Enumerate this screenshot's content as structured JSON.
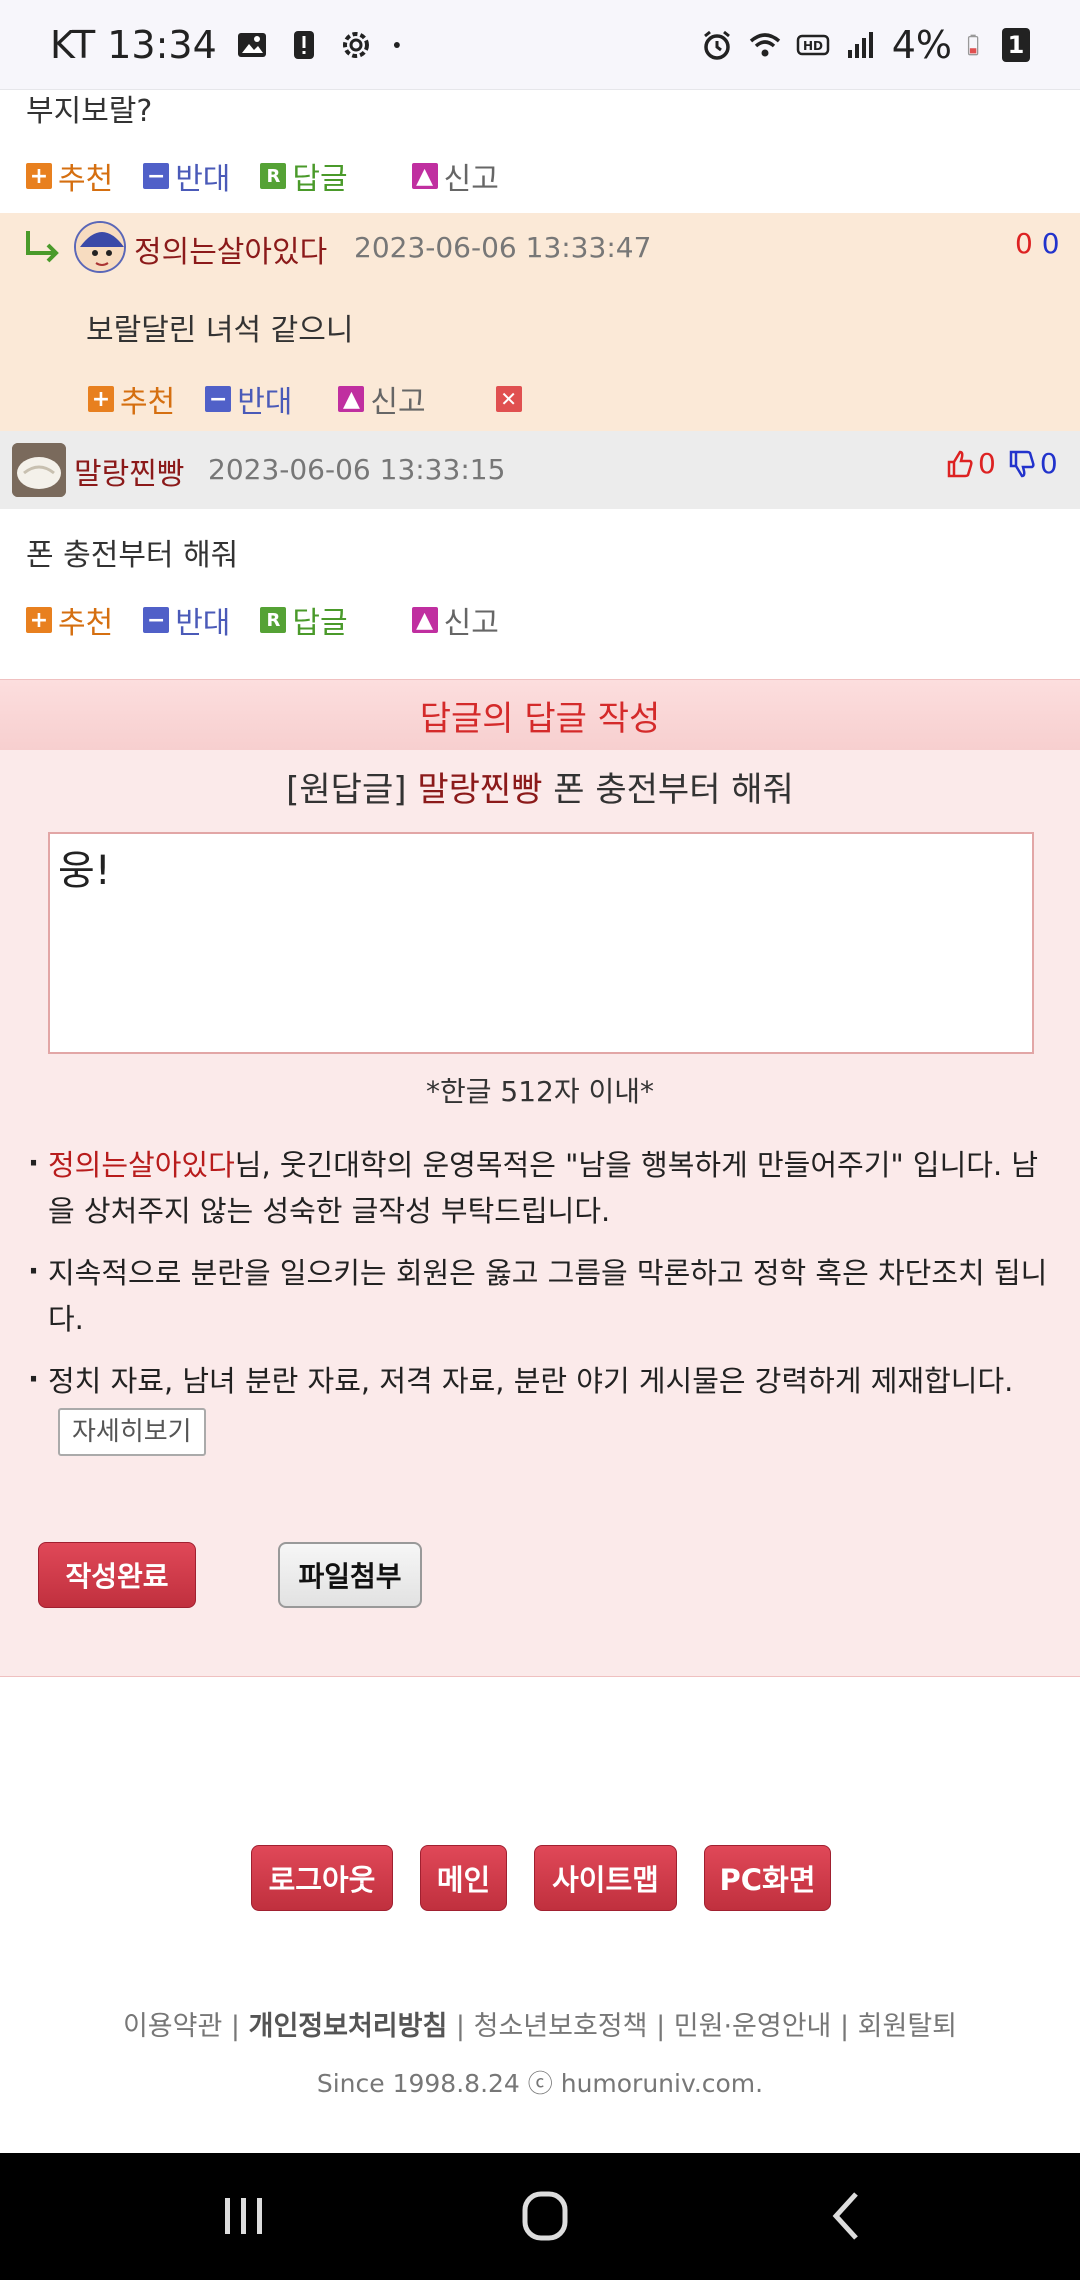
{
  "status_bar": {
    "carrier_time": "KT 13:34",
    "battery": "4%",
    "notification_count": "1"
  },
  "comment1": {
    "partial_text": "부지보랄?",
    "actions": {
      "up": "추천",
      "down": "반대",
      "reply": "답글",
      "report": "신고"
    }
  },
  "reply1": {
    "nickname": "정의는살아있다",
    "date": "2023-06-06 13:33:47",
    "up_count": "0",
    "down_count": "0",
    "text": "보랄달린 녀석 같으니",
    "actions": {
      "up": "추천",
      "down": "반대",
      "report": "신고"
    }
  },
  "comment2": {
    "nickname": "말랑찐빵",
    "date": "2023-06-06 13:33:15",
    "up_count": "0",
    "down_count": "0",
    "text": "폰 충전부터 해줘",
    "actions": {
      "up": "추천",
      "down": "반대",
      "reply": "답글",
      "report": "신고"
    }
  },
  "reply_form": {
    "title": "답글의 답글 작성",
    "orig_prefix": "[원답글]",
    "orig_nick": "말랑찐빵",
    "orig_text": "폰 충전부터 해줘",
    "textarea_value": "웅!",
    "limit": "*한글 512자 이내*",
    "note1_nick": "정의는살아있다",
    "note1_text": "님, 웃긴대학의 운영목적은 \"남을 행복하게 만들어주기\" 입니다. 남을 상처주지 않는 성숙한 글작성 부탁드립니다.",
    "note2_text": "지속적으로 분란을 일으키는 회원은 옳고 그름을 막론하고 정학 혹은 차단조치 됩니다.",
    "note3_text": "정치 자료, 남녀 분란 자료, 저격 자료, 분란 야기 게시물은 강력하게 제재합니다.",
    "detail_label": "자세히보기",
    "submit_label": "작성완료",
    "file_label": "파일첨부"
  },
  "footer": {
    "logout": "로그아웃",
    "main": "메인",
    "sitemap": "사이트맵",
    "pc": "PC화면",
    "link_terms": "이용약관",
    "link_privacy": "개인정보처리방침",
    "link_youth": "청소년보호정책",
    "link_guide": "민원·운영안내",
    "link_withdraw": "회원탈퇴",
    "since": "Since 1998.8.24  ⓒ humoruniv.com."
  },
  "colors": {
    "accent_red": "#c0303e",
    "nick_red": "#8b1a1a",
    "reply_bg": "#fbe9d7",
    "form_bg": "#fbeaea"
  }
}
